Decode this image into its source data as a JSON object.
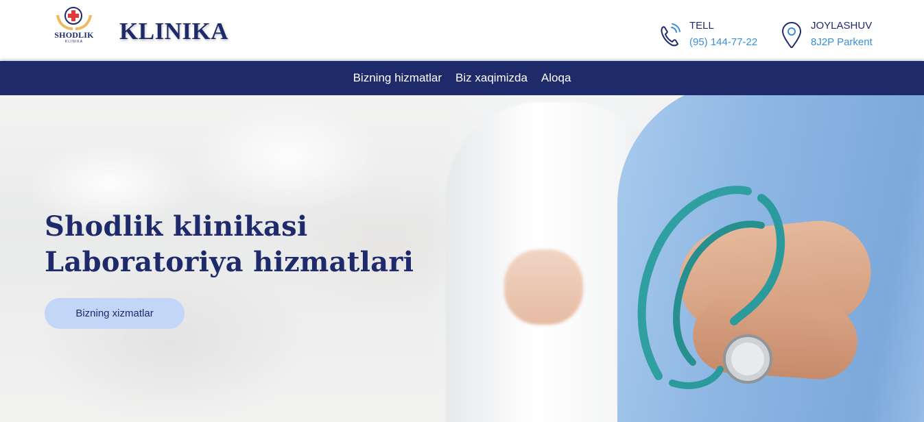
{
  "header": {
    "logo": {
      "text": "SHODLIK",
      "subtext": "KLINIKA"
    },
    "brand": "KLINIKA",
    "contacts": [
      {
        "icon": "phone-icon",
        "label": "TELL",
        "value": "(95) 144-77-22"
      },
      {
        "icon": "location-pin-icon",
        "label": "JOYLASHUV",
        "value": "8J2P Parkent"
      }
    ]
  },
  "nav": {
    "items": [
      "Bizning hizmatlar",
      "Biz xaqimizda",
      "Aloqa"
    ]
  },
  "hero": {
    "title_line1": "Shodlik klinikasi",
    "title_line2": "Laboratoriya hizmatlari",
    "button": "Bizning xizmatlar"
  },
  "colors": {
    "primary": "#1f2a6b",
    "accent": "#3a8ed6",
    "button_bg": "#c3d6f7"
  }
}
